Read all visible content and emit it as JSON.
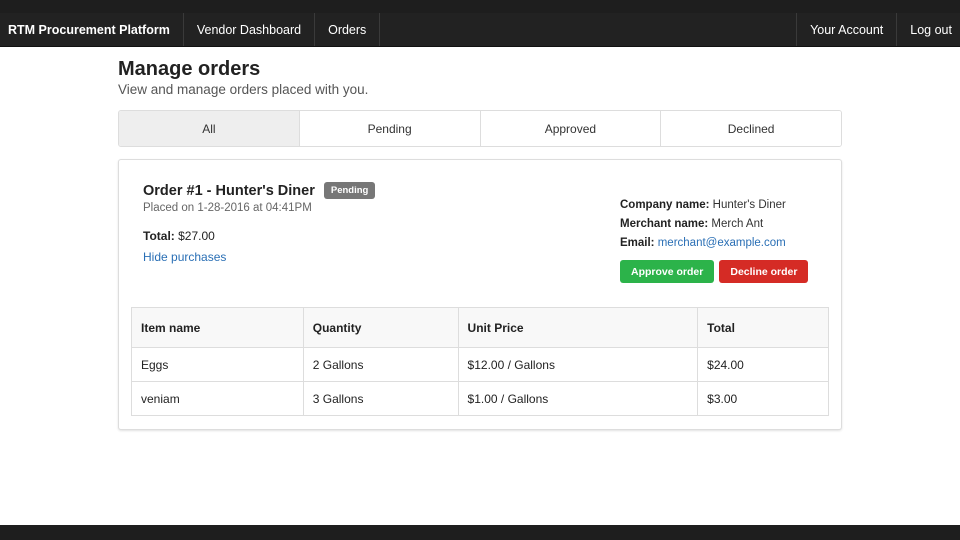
{
  "navbar": {
    "brand": "RTM Procurement Platform",
    "links": [
      "Vendor Dashboard",
      "Orders"
    ],
    "account": "Your Account",
    "logout": "Log out"
  },
  "page": {
    "title": "Manage orders",
    "subtitle": "View and manage orders placed with you."
  },
  "tabs": [
    "All",
    "Pending",
    "Approved",
    "Declined"
  ],
  "active_tab": "All",
  "order": {
    "title": "Order #1 - Hunter's Diner",
    "status": "Pending",
    "placed_on": "Placed on 1-28-2016 at 04:41PM",
    "total_label": "Total:",
    "total_value": "$27.00",
    "hide_link": "Hide purchases",
    "company_label": "Company name:",
    "company_value": "Hunter's Diner",
    "merchant_label": "Merchant name:",
    "merchant_value": "Merch Ant",
    "email_label": "Email:",
    "email_value": "merchant@example.com",
    "approve_label": "Approve order",
    "decline_label": "Decline order",
    "table": {
      "headers": [
        "Item name",
        "Quantity",
        "Unit Price",
        "Total"
      ],
      "rows": [
        [
          "Eggs",
          "2 Gallons",
          "$12.00 / Gallons",
          "$24.00"
        ],
        [
          "veniam",
          "3 Gallons",
          "$1.00 / Gallons",
          "$3.00"
        ]
      ]
    }
  },
  "colors": {
    "navbar": "#222222",
    "approve": "#2cb34a",
    "decline": "#d52b25",
    "badge": "#777777",
    "link": "#2a6fb5"
  }
}
